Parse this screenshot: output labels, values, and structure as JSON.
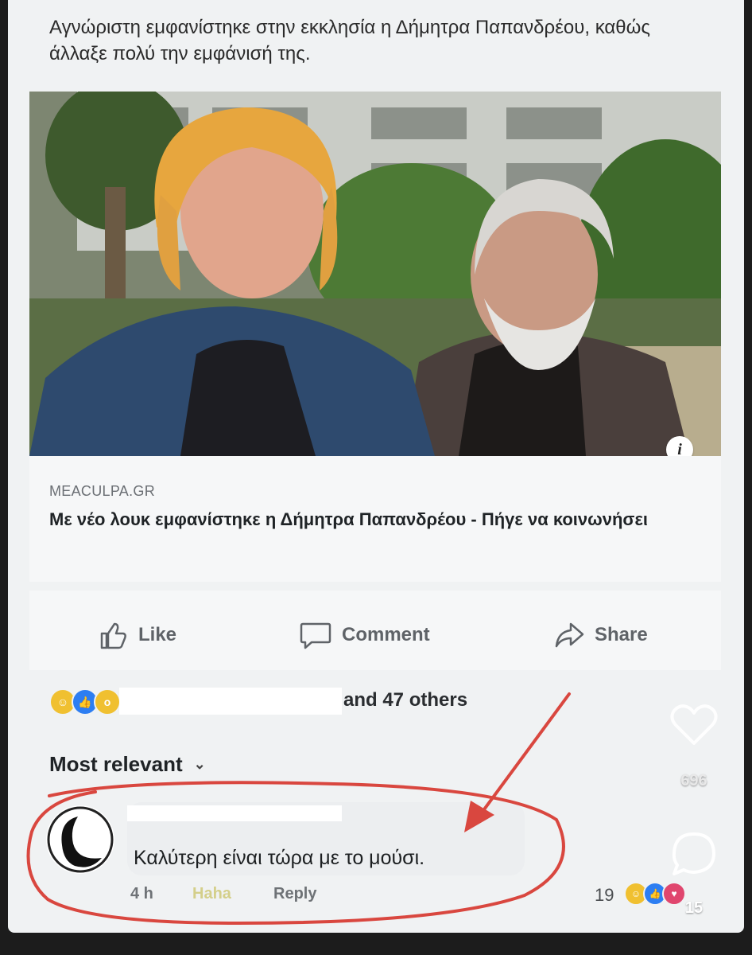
{
  "post": {
    "headline": "Αγνώριστη εμφανίστηκε στην εκκλησία η Δήμητρα Παπανδρέου, καθώς άλλαξε πολύ την εμφάνισή της.",
    "link_domain": "MEACULPA.GR",
    "link_title": "Με νέο λουκ εμφανίστηκε η Δήμητρα Παπανδρέου - Πήγε να κοινωνήσει",
    "info_icon": "i"
  },
  "actions": {
    "like_label": "Like",
    "comment_label": "Comment",
    "share_label": "Share"
  },
  "reactions": {
    "icons": [
      "haha",
      "like",
      "wow"
    ],
    "others_text": "and 47 others"
  },
  "comments": {
    "sort_label": "Most relevant",
    "items": [
      {
        "text": "Καλύτερη είναι τώρα με το μούσι.",
        "time": "4 h",
        "haha_label": "Haha",
        "reply_label": "Reply",
        "reaction_count": "19"
      }
    ]
  },
  "overlay": {
    "likes_count": "696",
    "comments_count": "15"
  },
  "colors": {
    "annotation_red": "#d9473f",
    "like_blue": "#2d7ef2",
    "haha_yellow": "#f0c030"
  }
}
